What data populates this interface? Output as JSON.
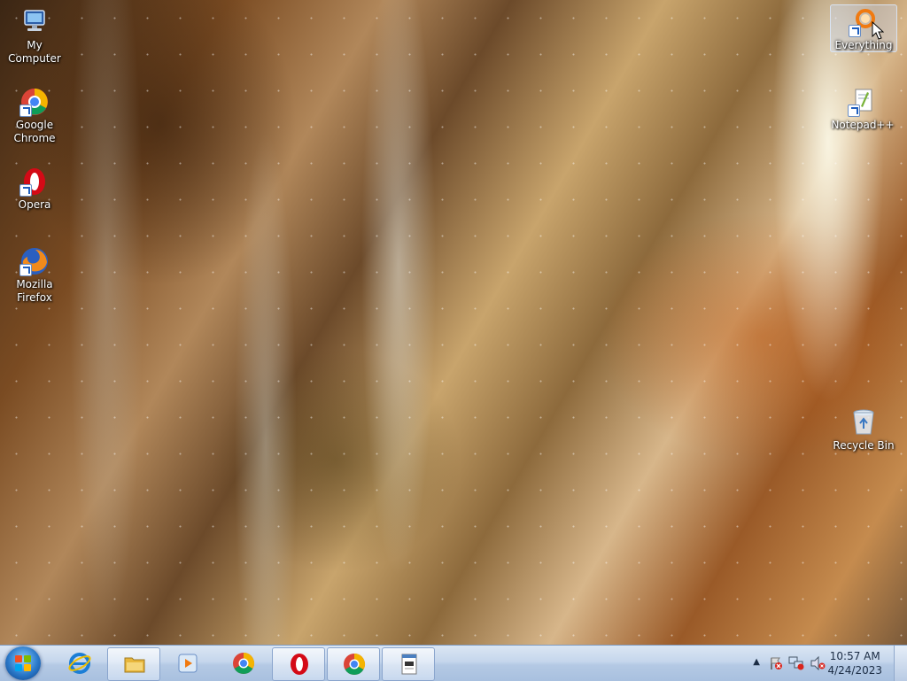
{
  "desktop": {
    "icons": [
      {
        "label": "My Computer"
      },
      {
        "label": "Google Chrome"
      },
      {
        "label": "Opera"
      },
      {
        "label": "Mozilla Firefox"
      },
      {
        "label": "Everything"
      },
      {
        "label": "Notepad++"
      },
      {
        "label": "Recycle Bin"
      }
    ]
  },
  "taskbar": {
    "pinned": [
      {
        "icon": "internet-explorer-icon"
      },
      {
        "icon": "file-explorer-icon"
      },
      {
        "icon": "media-player-icon"
      },
      {
        "icon": "chrome-icon"
      },
      {
        "icon": "opera-icon"
      },
      {
        "icon": "chrome-icon"
      },
      {
        "icon": "notepad-window-icon"
      }
    ],
    "clock": {
      "time": "10:57 AM",
      "date": "4/24/2023"
    }
  },
  "colors": {
    "taskbar": "#c5d6ec",
    "accent": "#2a79c9"
  }
}
